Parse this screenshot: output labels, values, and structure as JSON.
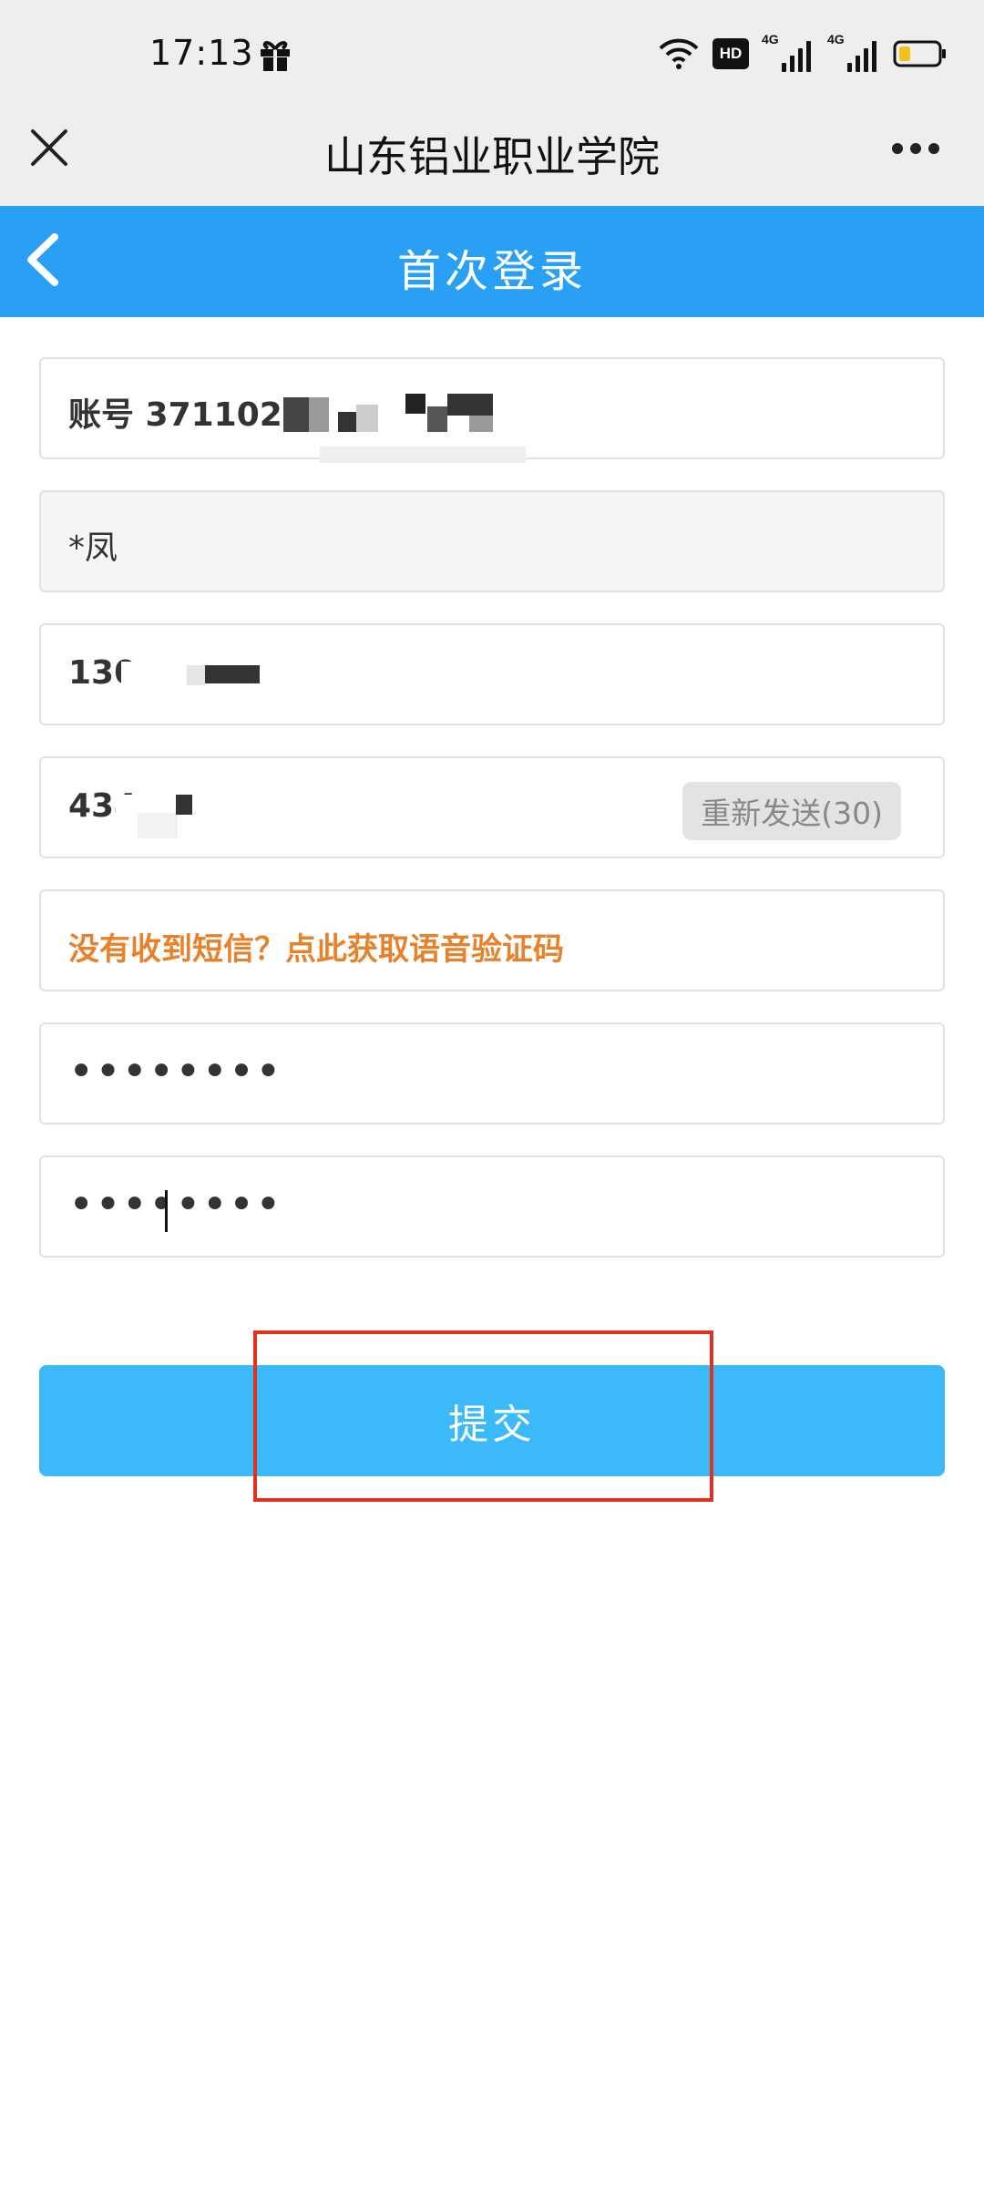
{
  "status_bar": {
    "time": "17:13",
    "hd_badge": "HD",
    "signal_1_label": "4G",
    "signal_2_label": "4G",
    "icons": [
      "gift-icon",
      "wifi-icon",
      "hd-icon",
      "signal-icon",
      "battery-icon"
    ]
  },
  "title_bar": {
    "title": "山东铝业职业学院",
    "icons": [
      "close-icon",
      "more-icon"
    ]
  },
  "header": {
    "title": "首次登录",
    "back_icon": "chevron-left-icon",
    "color": "#2aa0f5"
  },
  "form": {
    "account": "账号 3711021",
    "name": "*凤",
    "phone": "130",
    "sms_code": "434",
    "resend_label": "重新发送(30)",
    "voice_code_link": "没有收到短信？点此获取语音验证码",
    "password": "••••••••",
    "confirm_password": "••••••••"
  },
  "submit": {
    "label": "提交",
    "color": "#3cb9f8"
  },
  "colors": {
    "link": "#e8822a",
    "highlight": "#e0301e"
  }
}
